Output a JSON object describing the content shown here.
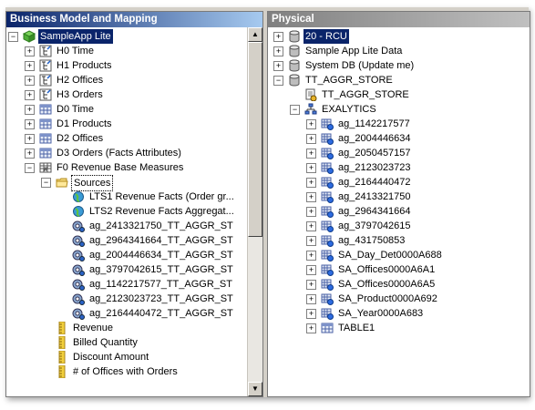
{
  "left_pane": {
    "title": "Business Model and Mapping",
    "root": "SampleApp Lite",
    "items": [
      "H0 Time",
      "H1 Products",
      "H2 Offices",
      "H3 Orders",
      "D0 Time",
      "D1 Products",
      "D2 Offices",
      "D3 Orders (Facts Attributes)",
      "F0 Revenue Base Measures"
    ],
    "sources_label": "Sources",
    "sources": [
      "LTS1 Revenue Facts (Order gr...",
      "LTS2 Revenue Facts Aggregat...",
      "ag_2413321750_TT_AGGR_ST",
      "ag_2964341664_TT_AGGR_ST",
      "ag_2004446634_TT_AGGR_ST",
      "ag_3797042615_TT_AGGR_ST",
      "ag_1142217577_TT_AGGR_ST",
      "ag_2123023723_TT_AGGR_ST",
      "ag_2164440472_TT_AGGR_ST"
    ],
    "measures": [
      "Revenue",
      "Billed Quantity",
      "Discount Amount",
      "# of Offices with Orders"
    ]
  },
  "right_pane": {
    "title": "Physical",
    "databases": [
      "20 - RCU",
      "Sample App Lite Data",
      "System DB (Update me)",
      "TT_AGGR_STORE"
    ],
    "pool": "TT_AGGR_STORE",
    "schema": "EXALYTICS",
    "tables": [
      "ag_1142217577",
      "ag_2004446634",
      "ag_2050457157",
      "ag_2123023723",
      "ag_2164440472",
      "ag_2413321750",
      "ag_2964341664",
      "ag_3797042615",
      "ag_431750853",
      "SA_Day_Det0000A688",
      "SA_Offices0000A6A1",
      "SA_Offices0000A6A5",
      "SA_Product0000A692",
      "SA_Year0000A683",
      "TABLE1"
    ]
  }
}
